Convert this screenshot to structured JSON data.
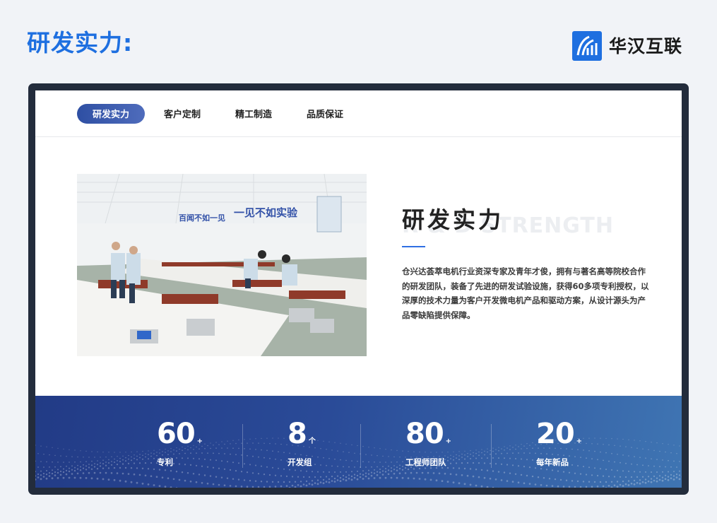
{
  "page": {
    "heading": "研发实力:"
  },
  "brand": {
    "name": "华汉互联",
    "mark_color": "#1e6fe0",
    "icon": "brand-logo-icon"
  },
  "tabs": [
    {
      "label": "研发实力",
      "active": true
    },
    {
      "label": "客户定制",
      "active": false
    },
    {
      "label": "精工制造",
      "active": false
    },
    {
      "label": "品质保证",
      "active": false
    }
  ],
  "photo": {
    "wall_slogan_left": "百闻不如一见",
    "wall_slogan_right": "一见不如实验",
    "next_icon": "chevron-right-icon"
  },
  "section": {
    "title": "研发实力",
    "bg_title": "R & D STRENGTH",
    "intro": "仓兴达荟萃电机行业资深专家及青年才俊，拥有与著名高等院校合作的研发团队，装备了先进的研发试验设施，获得60多项专利授权，以深厚的技术力量为客户开发微电机产品和驱动方案，从设计源头为产品零缺陷提供保障。"
  },
  "stats": [
    {
      "value": "60",
      "unit": "+",
      "label": "专利"
    },
    {
      "value": "8",
      "unit": "个",
      "label": "开发组"
    },
    {
      "value": "80",
      "unit": "+",
      "label": "工程师团队"
    },
    {
      "value": "20",
      "unit": "+",
      "label": "每年新品"
    }
  ],
  "colors": {
    "accent": "#1e6fe0",
    "tab_active": "#3a59ad",
    "frame": "#232c3c",
    "stats_band": "#2a4b98"
  }
}
